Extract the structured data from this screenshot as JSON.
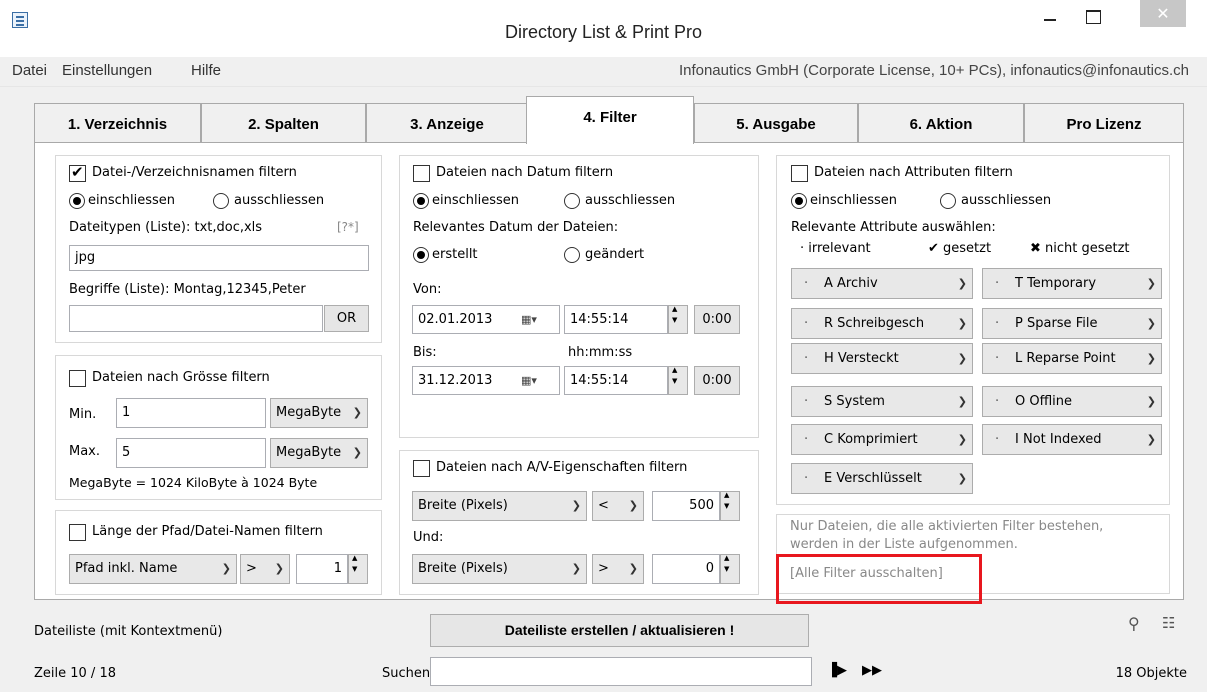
{
  "window": {
    "title": "Directory List & Print Pro",
    "close_glyph": "✕"
  },
  "menu": {
    "items": [
      "Datei",
      "Einstellungen",
      "Hilfe"
    ],
    "license": "Infonautics GmbH (Corporate License, 10+ PCs), infonautics@infonautics.ch"
  },
  "tabs": [
    "1. Verzeichnis",
    "2. Spalten",
    "3. Anzeige",
    "4. Filter",
    "5. Ausgabe",
    "6. Aktion",
    "Pro Lizenz"
  ],
  "active_tab": "4. Filter",
  "name_filter": {
    "checkbox_label": "Datei-/Verzeichnisnamen filtern",
    "checked": true,
    "include": "einschliessen",
    "exclude": "ausschliessen",
    "types_label": "Dateitypen (Liste): txt,doc,xls",
    "types_help": "[?*]",
    "types_value": "jpg",
    "terms_label": "Begriffe (Liste): Montag,12345,Peter",
    "terms_value": "",
    "or_button": "OR"
  },
  "size_filter": {
    "checkbox_label": "Dateien nach Grösse filtern",
    "min_label": "Min.",
    "min_value": "1",
    "min_unit": "MegaByte",
    "max_label": "Max.",
    "max_value": "5",
    "max_unit": "MegaByte",
    "note": "MegaByte = 1024 KiloByte à 1024 Byte"
  },
  "path_filter": {
    "checkbox_label": "Länge der Pfad/Datei-Namen filtern",
    "mode": "Pfad inkl. Name",
    "operator": ">",
    "value": "1"
  },
  "date_filter": {
    "checkbox_label": "Dateien nach Datum filtern",
    "include": "einschliessen",
    "exclude": "ausschliessen",
    "relevant_label": "Relevantes Datum der Dateien:",
    "created": "erstellt",
    "modified": "geändert",
    "from_label": "Von:",
    "from_date": "02.01.2013",
    "from_time": "14:55:14",
    "zero_button": "0:00",
    "to_label": "Bis:",
    "time_format": "hh:mm:ss",
    "to_date": "31.12.2013",
    "to_time": "14:55:14"
  },
  "av_filter": {
    "checkbox_label": "Dateien nach A/V-Eigenschaften filtern",
    "prop1": "Breite (Pixels)",
    "op1": "<",
    "value1": "500",
    "and_label": "Und:",
    "prop2": "Breite (Pixels)",
    "op2": ">",
    "value2": "0"
  },
  "attr_filter": {
    "checkbox_label": "Dateien nach Attributen filtern",
    "include": "einschliessen",
    "exclude": "ausschliessen",
    "relevant_label": "Relevante Attribute auswählen:",
    "legend_irrelevant": "· irrelevant",
    "legend_set": "✔ gesetzt",
    "legend_unset": "✖ nicht gesetzt",
    "attributes": [
      "A Archiv",
      "T Temporary",
      "R Schreibgesch",
      "P Sparse File",
      "H Versteckt",
      "L Reparse Point",
      "S System",
      "O Offline",
      "C Komprimiert",
      "I  Not Indexed",
      "E Verschlüsselt"
    ]
  },
  "info": {
    "line1": "Nur Dateien, die alle aktivierten Filter bestehen,",
    "line2": "werden in der Liste aufgenommen.",
    "disable_all": "[Alle Filter ausschalten]",
    "highlight_color": "#e8171e"
  },
  "bottom": {
    "list_label": "Dateiliste (mit Kontextmenü)",
    "create_button": "Dateiliste erstellen / aktualisieren !",
    "row_status": "Zeile 10 / 18",
    "search_label": "Suchen",
    "search_value": "",
    "objects": "18 Objekte"
  }
}
